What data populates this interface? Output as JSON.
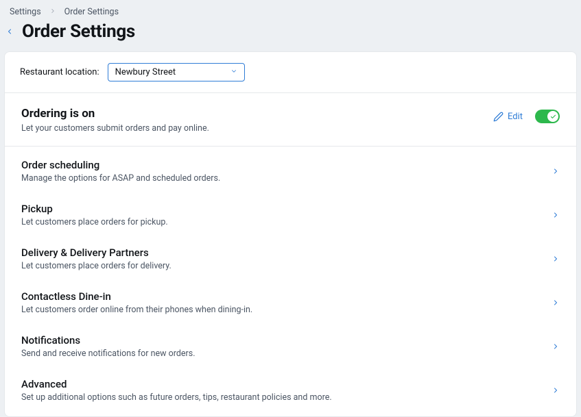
{
  "breadcrumb": {
    "root": "Settings",
    "current": "Order Settings"
  },
  "page_title": "Order Settings",
  "location": {
    "label": "Restaurant location:",
    "selected": "Newbury Street"
  },
  "status": {
    "title": "Ordering is on",
    "description": "Let your customers submit orders and pay online.",
    "edit_label": "Edit",
    "toggle_on": true
  },
  "sections": [
    {
      "title": "Order scheduling",
      "description": "Manage the options for ASAP and scheduled orders."
    },
    {
      "title": "Pickup",
      "description": "Let customers place orders for pickup."
    },
    {
      "title": "Delivery & Delivery Partners",
      "description": "Let customers place orders for delivery."
    },
    {
      "title": "Contactless Dine-in",
      "description": "Let customers order online from their phones when dining-in."
    },
    {
      "title": "Notifications",
      "description": "Send and receive notifications for new orders."
    },
    {
      "title": "Advanced",
      "description": "Set up additional options such as future orders, tips, restaurant policies and more."
    }
  ]
}
